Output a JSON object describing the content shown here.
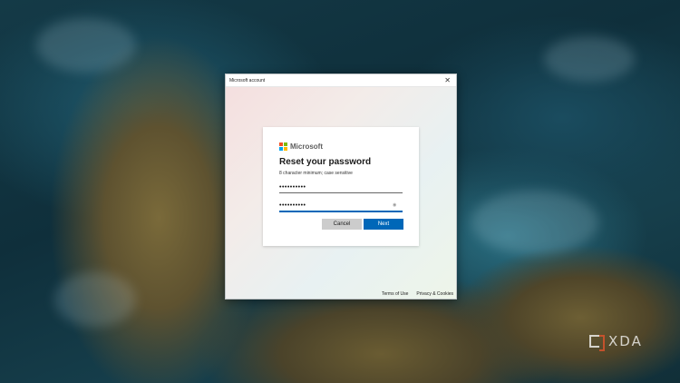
{
  "window": {
    "title": "Microsoft account",
    "close_glyph": "✕"
  },
  "card": {
    "brand": "Microsoft",
    "logo_colors": [
      "#f25022",
      "#7fba00",
      "#00a4ef",
      "#ffb900"
    ],
    "title": "Reset your password",
    "subtitle": "8 character minimum; case sensitive",
    "password_value": "••••••••••",
    "confirm_value": "••••••••••",
    "reveal_icon": "eye-icon",
    "cancel_label": "Cancel",
    "next_label": "Next",
    "accent": "#0067b8"
  },
  "footer": {
    "terms": "Terms of Use",
    "privacy": "Privacy & Cookies"
  },
  "watermark": {
    "text": "XDA"
  }
}
